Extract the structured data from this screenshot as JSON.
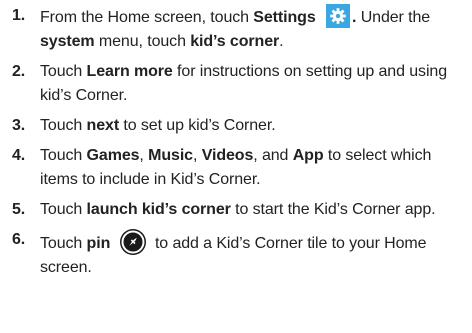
{
  "steps": [
    {
      "number": "1.",
      "parts": {
        "a": "From the Home screen, touch ",
        "b": "Settings",
        "c": ".",
        "d": " Under the ",
        "e": "system",
        "f": " menu, touch ",
        "g": "kid’s corner",
        "h": "."
      },
      "icon": "settings-gear-icon"
    },
    {
      "number": "2.",
      "parts": {
        "a": "Touch ",
        "b": "Learn more",
        "c": " for instructions on setting up and using kid’s Corner."
      }
    },
    {
      "number": "3.",
      "parts": {
        "a": "Touch ",
        "b": "next",
        "c": " to set up kid’s Corner."
      }
    },
    {
      "number": "4.",
      "parts": {
        "a": "Touch ",
        "b": "Games",
        "c": ", ",
        "d": "Music",
        "e": ", ",
        "f": "Videos",
        "g": ", and ",
        "h": "App",
        "i": " to select which items to include in Kid’s Corner."
      }
    },
    {
      "number": "5.",
      "parts": {
        "a": "Touch ",
        "b": "launch kid’s corner",
        "c": " to start the Kid’s Corner app."
      }
    },
    {
      "number": "6.",
      "parts": {
        "a": "Touch ",
        "b": "pin",
        "c": " to add a Kid’s Corner tile to your Home screen."
      },
      "icon": "pin-icon"
    }
  ],
  "colors": {
    "text": "#222222",
    "settings_icon_bg": "#3aa7e3",
    "pin_icon_bg": "#1a1a1a"
  }
}
